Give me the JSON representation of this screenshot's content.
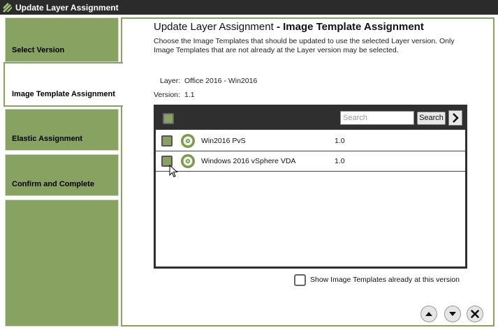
{
  "window": {
    "title": "Update Layer Assignment"
  },
  "steps": [
    {
      "label": "Select Version"
    },
    {
      "label": "Image Template Assignment"
    },
    {
      "label": "Elastic Assignment"
    },
    {
      "label": "Confirm and Complete"
    }
  ],
  "active_step": 1,
  "main": {
    "heading_prefix": "Update Layer Assignment",
    "heading_suffix": " - Image Template Assignment",
    "description": "Choose the Image Templates that should be updated to use the selected Layer version. Only Image Templates that are not already at the Layer version may be selected.",
    "layer_label": "Layer:",
    "layer_value": "Office 2016 - Win2016",
    "version_label": "Version:",
    "version_value": "1.1"
  },
  "list": {
    "search_placeholder": "Search",
    "search_button": "Search",
    "rows": [
      {
        "name": "Win2016 PvS",
        "version": "1.0"
      },
      {
        "name": "Windows 2016 vSphere VDA",
        "version": "1.0"
      }
    ]
  },
  "options": {
    "show_label": "Show Image Templates already at this version"
  },
  "colors": {
    "accent": "#87a261",
    "titlebar": "#2b2b2b",
    "listhead": "#2f2f2f"
  },
  "icons": {
    "logo": "layers-logo-icon",
    "next": "chevron-right-icon",
    "template": "disc-icon",
    "up": "arrow-up-icon",
    "down": "arrow-down-icon",
    "close": "close-icon"
  }
}
